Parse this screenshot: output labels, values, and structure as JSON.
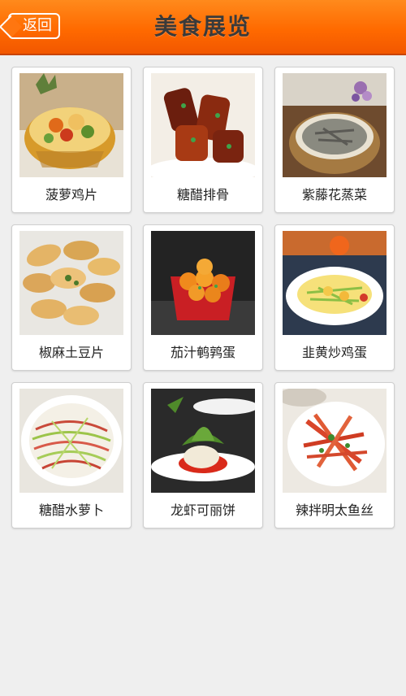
{
  "header": {
    "back_label": "返回",
    "title": "美食展览"
  },
  "dishes": [
    {
      "name": "菠萝鸡片"
    },
    {
      "name": "糖醋排骨"
    },
    {
      "name": "紫藤花蒸菜"
    },
    {
      "name": "椒麻土豆片"
    },
    {
      "name": "茄汁鹌鹑蛋"
    },
    {
      "name": "韭黄炒鸡蛋"
    },
    {
      "name": "糖醋水萝卜"
    },
    {
      "name": "龙虾可丽饼"
    },
    {
      "name": "辣拌明太鱼丝"
    }
  ]
}
